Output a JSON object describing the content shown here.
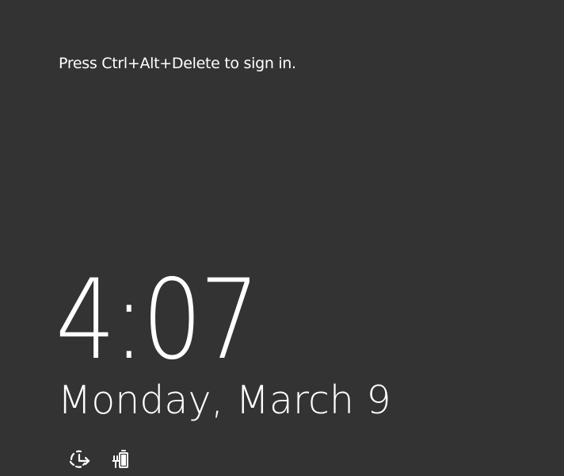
{
  "lock_screen": {
    "sign_in_hint": "Press Ctrl+Alt+Delete to sign in.",
    "time": "4:07",
    "date": "Monday, March 9"
  },
  "status_icons": [
    {
      "name": "network-icon"
    },
    {
      "name": "battery-charging-icon"
    }
  ],
  "colors": {
    "background": "#333333",
    "text": "#ffffff"
  }
}
